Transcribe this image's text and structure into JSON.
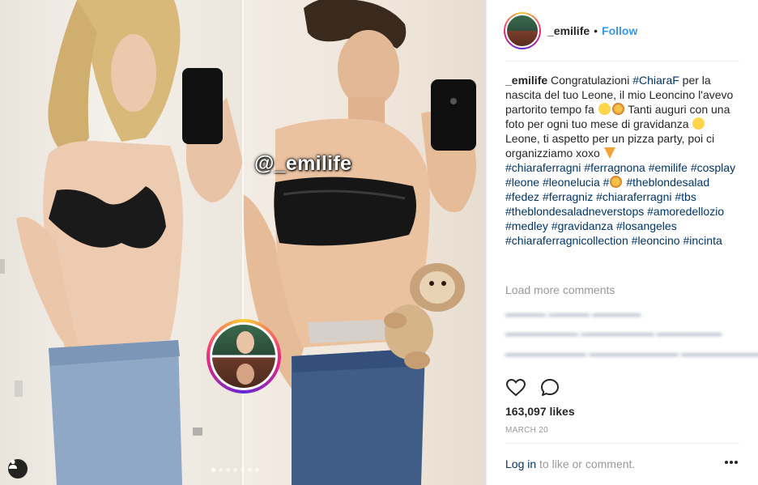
{
  "media": {
    "watermark": "@_emilife",
    "carousel": {
      "count": 7,
      "active_index": 0
    }
  },
  "header": {
    "username": "_emilife",
    "separator": "•",
    "follow_label": "Follow"
  },
  "caption": {
    "username": "_emilife",
    "text_1": "Congratulazioni ",
    "tag_chiara": "#ChiaraF",
    "text_2": " per la nascita del tuo Leone, il mio Leoncino l'avevo partorito tempo fa ",
    "text_3": " Tanti auguri con una foto per ogni tuo mese di gravidanza ",
    "text_4": "Leone, ti aspetto per un pizza party, poi ci organizziamo xoxo ",
    "hashtags": [
      "#chiaraferragni",
      "#ferragnona",
      "#emilife",
      "#cosplay",
      "#leone",
      "#leonelucia",
      "#",
      "#theblondesalad",
      "#fedez",
      "#ferragniz",
      "#chiaraferragni",
      "#tbs",
      "#theblondesaladneverstops",
      "#amoredellozio",
      "#medley",
      "#gravidanza",
      "#losangeles",
      "#chiaraferragnicollection",
      "#leoncino",
      "#incinta"
    ]
  },
  "comments": {
    "load_more": "Load more comments"
  },
  "stats": {
    "likes": "163,097 likes",
    "date": "MARCH 20"
  },
  "footer": {
    "login": "Log in",
    "rest": " to like or comment."
  },
  "icons": {
    "like": "heart-icon",
    "comment": "comment-icon",
    "tag": "user-tag-icon",
    "more": "more-options-icon"
  },
  "colors": {
    "link_blue": "#3897f0",
    "hashtag_navy": "#003569",
    "muted": "#999999"
  }
}
